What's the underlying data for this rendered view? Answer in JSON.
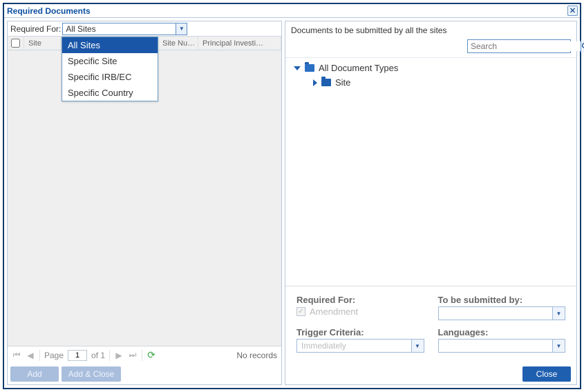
{
  "window": {
    "title": "Required Documents"
  },
  "filter": {
    "label": "Required For:",
    "value": "All Sites",
    "options": [
      "All Sites",
      "Specific Site",
      "Specific IRB/EC",
      "Specific Country"
    ]
  },
  "grid": {
    "columns": {
      "site": "Site",
      "siteNum": "Site Nu…",
      "pi": "Principal Investi…"
    }
  },
  "paging": {
    "pageLabel": "Page",
    "page": "1",
    "ofLabel": "of 1",
    "status": "No records"
  },
  "leftButtons": {
    "add": "Add",
    "addClose": "Add & Close"
  },
  "right": {
    "heading": "Documents to be submitted by all the sites",
    "searchPlaceholder": "Search",
    "treeRoot": "All Document Types",
    "treeChild": "Site"
  },
  "details": {
    "requiredForLabel": "Required For:",
    "amendment": "Amendment",
    "submittedByLabel": "To be submitted by:",
    "submittedByValue": "",
    "triggerLabel": "Trigger Criteria:",
    "triggerValue": "Immediately",
    "languagesLabel": "Languages:",
    "languagesValue": ""
  },
  "footer": {
    "close": "Close"
  }
}
